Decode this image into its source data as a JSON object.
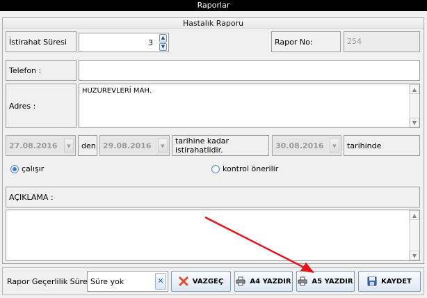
{
  "window": {
    "title": "Raporlar"
  },
  "group": {
    "title": "Hastalık Raporu"
  },
  "rest_period": {
    "label": "İstirahat Süresi",
    "value": "3"
  },
  "report_no": {
    "label": "Rapor No:",
    "value": "254"
  },
  "phone": {
    "label": "Telefon :",
    "value": ""
  },
  "address": {
    "label": "Adres :",
    "value": "HUZUREVLERİ MAH."
  },
  "dates": {
    "start": "27.08.2016",
    "between": "den",
    "end": "29.08.2016",
    "until_text": "tarihine kadar istirahatlidir.",
    "issue": "30.08.2016",
    "issue_text": "tarihinde"
  },
  "radio": {
    "works": {
      "label": "çalışır",
      "checked": true
    },
    "control": {
      "label": "kontrol önerilir",
      "checked": false
    }
  },
  "description": {
    "label": "AÇIKLAMA :",
    "value": ""
  },
  "validity": {
    "label": "Rapor Geçerlilik Süresi :",
    "value": "Süre yok"
  },
  "buttons": {
    "cancel": "VAZGEÇ",
    "a4": "A4 YAZDIR",
    "a5": "A5 YAZDIR",
    "save": "KAYDET"
  },
  "colors": {
    "annotation_arrow": "#e8121b",
    "accent": "#3c7fd0"
  },
  "icons": {
    "cancel": "x-icon",
    "print": "printer-icon",
    "save": "floppy-disk-icon"
  }
}
